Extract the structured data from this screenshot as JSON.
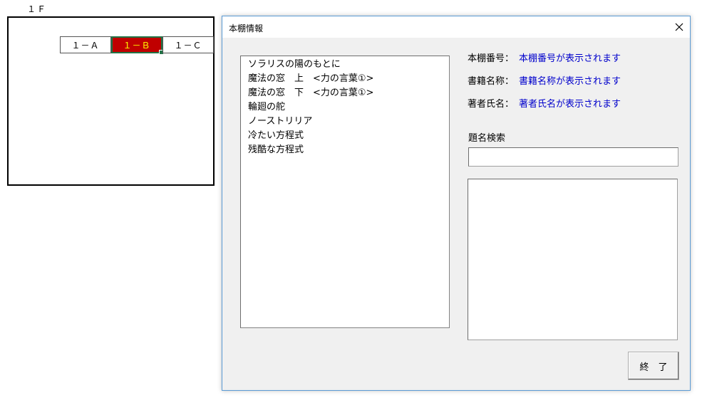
{
  "floor": {
    "label": "１Ｆ",
    "shelves": [
      {
        "label": "１－Ａ",
        "selected": false
      },
      {
        "label": "１－Ｂ",
        "selected": true
      },
      {
        "label": "１－Ｃ",
        "selected": false
      }
    ],
    "selected_fill": "#c00000",
    "selected_text": "#ffff00",
    "selection_border": "#217346"
  },
  "dialog": {
    "title": "本棚情報",
    "close_icon": "close-icon",
    "list_items": [
      "ソラリスの陽のもとに",
      "魔法の窓　上　<力の言葉①>",
      "魔法の窓　下　<力の言葉①>",
      "輪廻の舵",
      "ノーストリリア",
      "冷たい方程式",
      "残酷な方程式"
    ],
    "info": {
      "shelf_number_label": "本棚番号：",
      "shelf_number_value": "本棚番号が表示されます",
      "book_name_label": "書籍名称：",
      "book_name_value": "書籍名称が表示されます",
      "author_label": "著者氏名：",
      "author_value": "著者氏名が表示されます",
      "value_color": "#0000cc"
    },
    "search": {
      "label": "題名検索",
      "value": "",
      "placeholder": ""
    },
    "end_button_label": "終　了"
  }
}
